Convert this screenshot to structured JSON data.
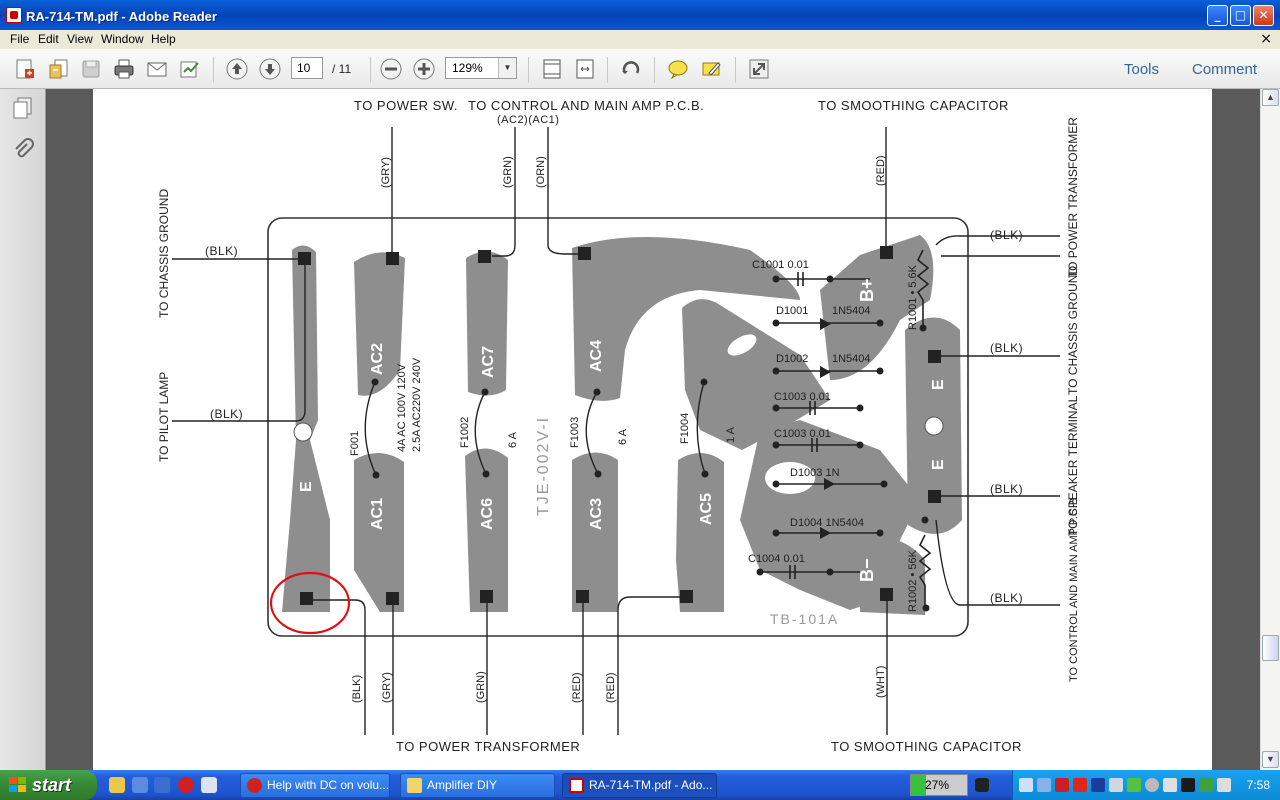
{
  "window": {
    "title": "RA-714-TM.pdf - Adobe Reader"
  },
  "menubar": {
    "items": [
      "File",
      "Edit",
      "View",
      "Window",
      "Help"
    ]
  },
  "toolbar": {
    "page_current": "10",
    "page_total": "/ 11",
    "zoom": "129%",
    "tools_label": "Tools",
    "comment_label": "Comment"
  },
  "document": {
    "top_labels": {
      "power_sw": "TO POWER SW.",
      "control_main": "TO  CONTROL AND MAIN AMP P.C.B.",
      "ac2ac1": "(AC2)(AC1)",
      "smoothing_top": "TO  SMOOTHING  CAPACITOR"
    },
    "bottom_labels": {
      "power_transformer": "TO  POWER TRANSFORMER",
      "smoothing_bottom": "TO  SMOOTHING CAPACITOR"
    },
    "left_labels": {
      "chassis_ground": "TO CHASSIS GROUND",
      "pilot_lamp": "TO PILOT LAMP",
      "blk1": "(BLK)",
      "blk2": "(BLK)"
    },
    "right_labels": {
      "power_transformer": "TO POWER TRANSFORMER",
      "chassis_ground": "TO CHASSIS GROUND",
      "speaker_terminal": "TO SPEAKER TERMINAL",
      "control_main": "TO CONTROL AND MAIN AMP P.C.B",
      "blk1": "(BLK)",
      "blk2": "(BLK)",
      "blk3": "(BLK)",
      "blk4": "(BLK)"
    },
    "top_wire_colors": [
      "(GRY)",
      "(GRN)",
      "(ORN)",
      "(RED)"
    ],
    "bottom_wire_colors": [
      "(BLK)",
      "(GRY)",
      "(GRN)",
      "(RED)",
      "(RED)",
      "(WHT)"
    ],
    "pads": [
      "AC2",
      "AC7",
      "AC4",
      "AC1",
      "AC6",
      "AC3",
      "AC5",
      "E",
      "E",
      "E"
    ],
    "fuses": {
      "f001": "F001",
      "f001_spec1": "4A  AC 100V 120V",
      "f001_spec2": "2.5A  AC220V 240V",
      "f1002": "F1002",
      "f1002_val": "6 A",
      "f1003": "F1003",
      "f1003_val": "6 A",
      "f1004": "F1004",
      "f1004_val": "1 A"
    },
    "components": {
      "c1001": "C1001  0.01",
      "d1001": "D1001",
      "d1001_val": "1N5404",
      "d1002": "D1002",
      "d1002_val": "1N5404",
      "c1003a": "C1003  0.01",
      "c1003b": "C1003  0.01",
      "d1003": "D1003  1N",
      "d1004": "D1004  1N5404",
      "c1004": "C1004  0.01",
      "r1001": "R1001 • 5.6K",
      "r1002": "R1002 • 56K",
      "b_plus": "B+",
      "b_minus": "B−"
    },
    "board_id": "TJE-002V-I",
    "board_code": "TB-101A"
  },
  "taskbar": {
    "start": "start",
    "tasks": [
      "Help with DC on volu...",
      "Amplifier DIY",
      "RA-714-TM.pdf - Ado..."
    ],
    "battery": "27%",
    "battery_level": 0.27,
    "clock": "7:58"
  }
}
